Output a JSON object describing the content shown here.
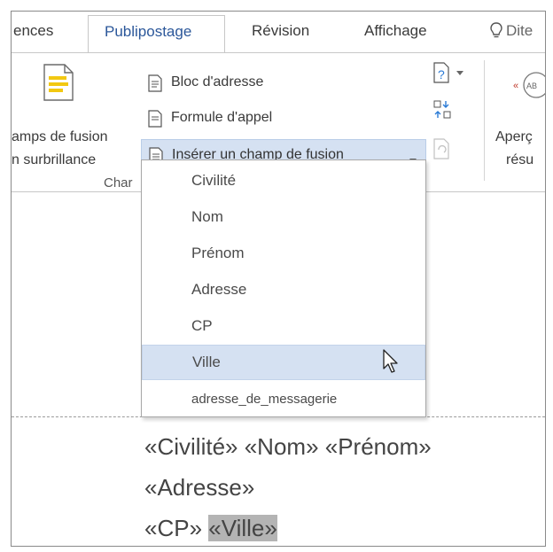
{
  "tabs": {
    "partial_left": "ences",
    "active": "Publipostage",
    "revision": "Révision",
    "affichage": "Affichage",
    "partial_right": "Dite"
  },
  "ribbon": {
    "highlight_fields": {
      "line1": "amps de fusion",
      "line2": "n surbrillance"
    },
    "address_block": "Bloc d'adresse",
    "greeting_line": "Formule d'appel",
    "insert_merge_field": "Insérer un champ de fusion",
    "group_label_partial": "Char",
    "preview": {
      "line1": "Aperç",
      "line2": "résu"
    }
  },
  "dropdown": {
    "items": [
      "Civilité",
      "Nom",
      "Prénom",
      "Adresse",
      "CP",
      "Ville",
      "adresse_de_messagerie"
    ],
    "selected": "Ville"
  },
  "document": {
    "line1": "«Civilité» «Nom» «Prénom»",
    "line2": "«Adresse»",
    "line3_a": "«CP» ",
    "line3_b": "«Ville»"
  },
  "colors": {
    "accent": "#2b579a",
    "selection": "#d5e1f2",
    "field_highlight": "#b4b4b4"
  }
}
